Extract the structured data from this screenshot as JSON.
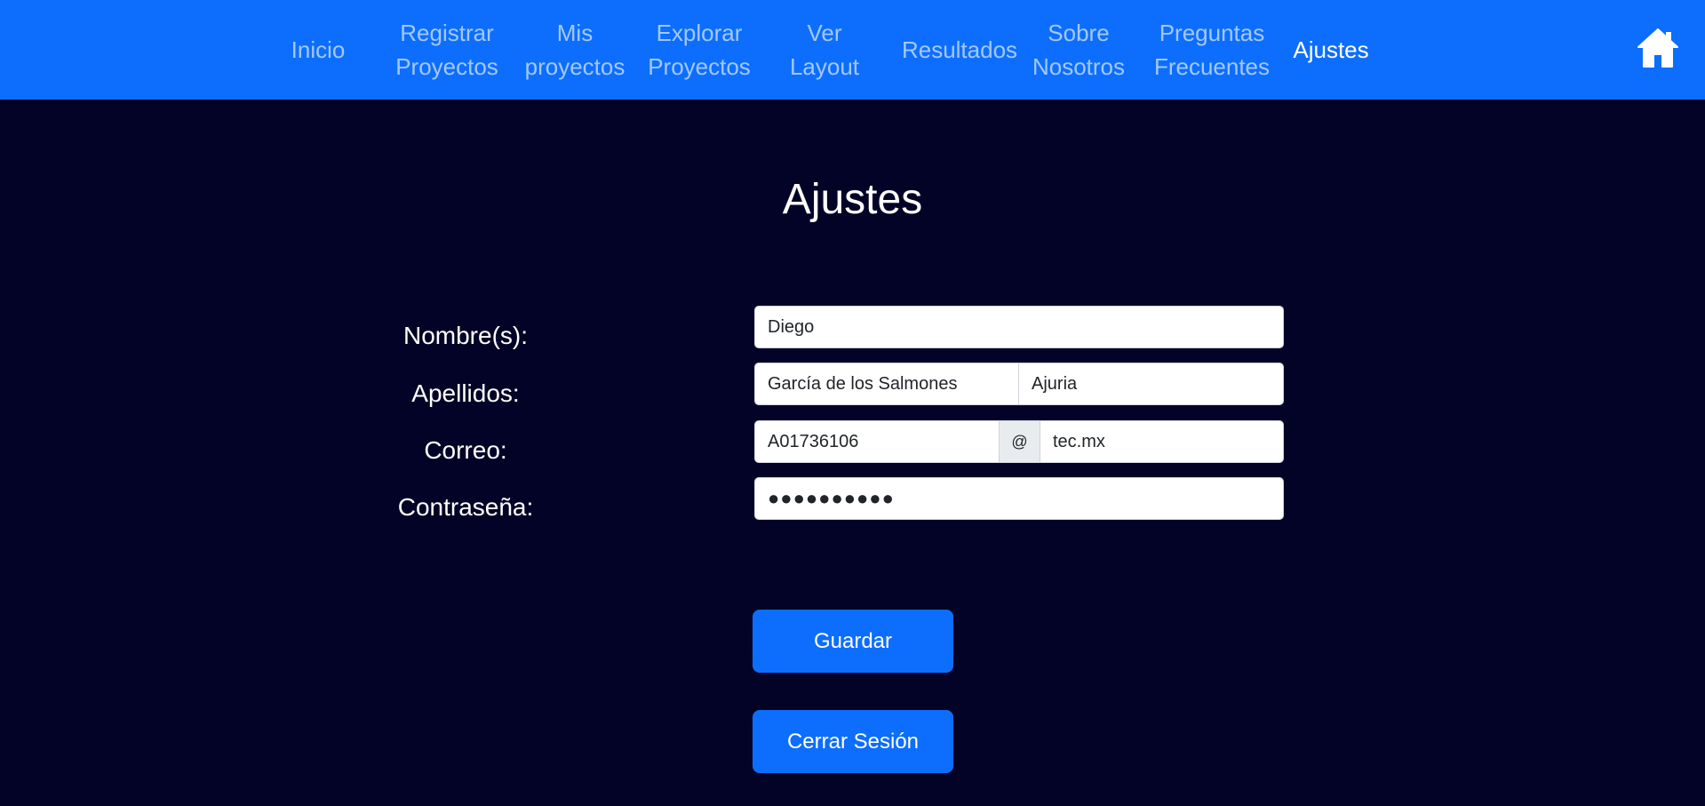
{
  "nav": {
    "items": [
      {
        "label": "Inicio"
      },
      {
        "label": "Registrar\nProyectos"
      },
      {
        "label": "Mis\nproyectos"
      },
      {
        "label": "Explorar\nProyectos"
      },
      {
        "label": "Ver\nLayout"
      },
      {
        "label": "Resultados"
      },
      {
        "label": "Sobre\nNosotros"
      },
      {
        "label": "Preguntas\nFrecuentes"
      },
      {
        "label": "Ajustes"
      }
    ],
    "active": "Ajustes",
    "home_icon": "home-icon",
    "bar_color": "#0d6efd"
  },
  "page": {
    "title": "Ajustes",
    "background": "#020326"
  },
  "form": {
    "nombre_label": "Nombre(s):",
    "nombre_value": "Diego",
    "apellidos_label": "Apellidos:",
    "apellido_paterno_value": "García de los Salmones",
    "apellido_materno_value": "Ajuria",
    "correo_label": "Correo:",
    "correo_user_value": "A01736106",
    "correo_at": "@",
    "correo_domain_value": "tec.mx",
    "contrasena_label": "Contraseña:",
    "contrasena_value": "●●●●●●●●●●"
  },
  "buttons": {
    "guardar": "Guardar",
    "cerrar_sesion": "Cerrar Sesión",
    "color": "#0d6efd"
  }
}
